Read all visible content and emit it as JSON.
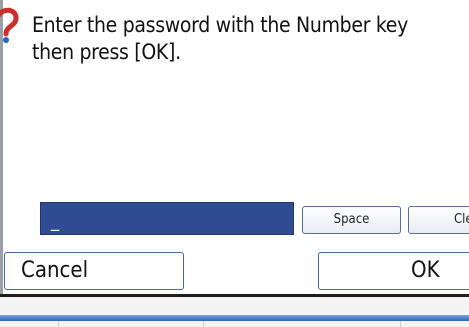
{
  "prompt": {
    "line1": "Enter the password with the Number key",
    "line2": "then press [OK]."
  },
  "password": {
    "value": "_"
  },
  "buttons": {
    "space": "Space",
    "clear": "Cle",
    "cancel": "Cancel",
    "ok": "OK"
  },
  "icons": {
    "prompt_icon": "question-icon"
  },
  "colors": {
    "field_bg": "#2f4c93",
    "button_border": "#4b64a8",
    "bar": "#2f63b8"
  }
}
